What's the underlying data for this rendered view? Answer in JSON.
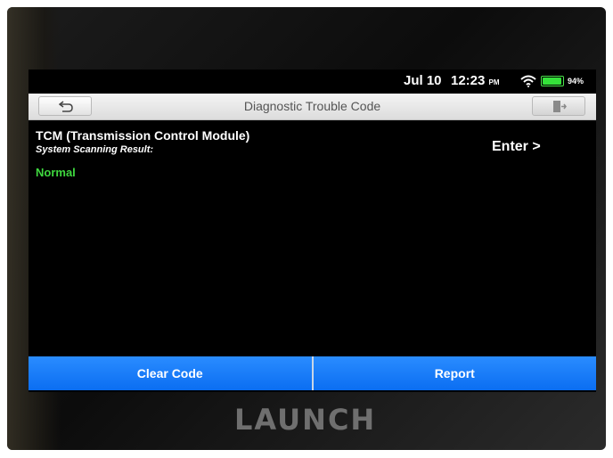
{
  "status_bar": {
    "date": "Jul 10",
    "time": "12:23",
    "ampm": "PM",
    "battery_percent": "94%",
    "battery_level": 0.94
  },
  "title_bar": {
    "title": "Diagnostic Trouble Code"
  },
  "result": {
    "module_name": "TCM (Transmission Control Module)",
    "scan_label": "System Scanning Result:",
    "status": "Normal",
    "status_color": "#3fd83f",
    "enter_label": "Enter >"
  },
  "actions": {
    "clear_label": "Clear Code",
    "report_label": "Report",
    "accent_color": "#0b6ef2"
  },
  "device": {
    "brand": "LAUNCH"
  }
}
